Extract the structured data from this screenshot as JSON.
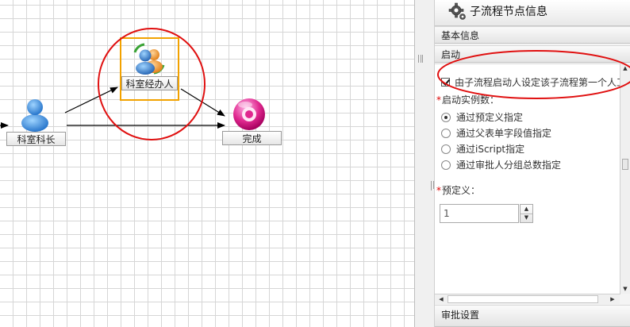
{
  "canvas": {
    "nodes": {
      "section_chief": {
        "label": "科室科长"
      },
      "clerk": {
        "label": "科室经办人"
      },
      "done": {
        "label": "完成"
      }
    }
  },
  "panel": {
    "title": "子流程节点信息",
    "basic_info": "基本信息",
    "startup": "启动",
    "checkbox_label": "由子流程启动人设定该子流程第一个人工",
    "instance_count_label": "启动实例数：",
    "options": [
      {
        "label": "通过预定义指定",
        "selected": true
      },
      {
        "label": "通过父表单字段值指定",
        "selected": false
      },
      {
        "label": "通过iScript指定",
        "selected": false
      },
      {
        "label": "通过审批人分组总数指定",
        "selected": false
      }
    ],
    "predefined_label": "预定义：",
    "predefined_value": "1",
    "approval_settings": "审批设置"
  },
  "colors": {
    "selection_border": "#f2a200",
    "annotation_red": "#e01010",
    "required_star": "#dd0000"
  },
  "icons": [
    "user-icon",
    "group-users-icon",
    "end-node-icon",
    "gear-icon"
  ]
}
